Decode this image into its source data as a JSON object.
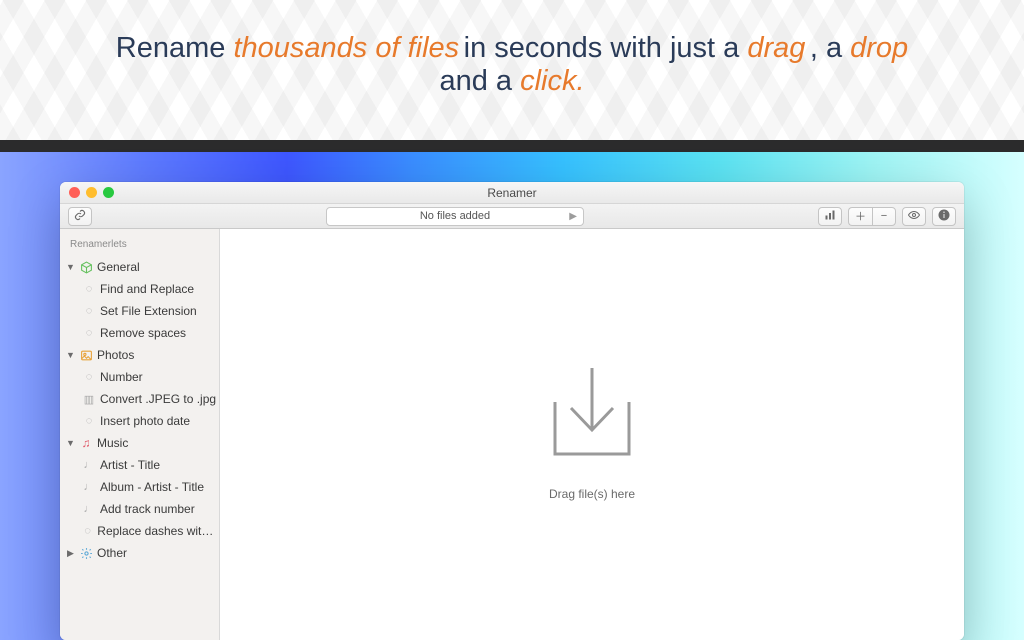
{
  "promo": {
    "p1": "Rename ",
    "em1": "thousands of files",
    "p2": " in seconds with just a ",
    "em2": "drag",
    "p3": ", a ",
    "em3": "drop",
    "p4": " and a ",
    "em4": "click.",
    "p5": ""
  },
  "window": {
    "title": "Renamer",
    "status": "No files added"
  },
  "sidebar": {
    "header": "Renamerlets",
    "groups": [
      {
        "label": "General",
        "items": [
          {
            "label": "Find and Replace"
          },
          {
            "label": "Set File Extension"
          },
          {
            "label": "Remove spaces"
          }
        ]
      },
      {
        "label": "Photos",
        "items": [
          {
            "label": "Number"
          },
          {
            "label": "Convert .JPEG to .jpg"
          },
          {
            "label": "Insert photo date"
          }
        ]
      },
      {
        "label": "Music",
        "items": [
          {
            "label": "Artist - Title"
          },
          {
            "label": "Album - Artist - Title"
          },
          {
            "label": "Add track number"
          },
          {
            "label": "Replace dashes with unde..."
          }
        ]
      },
      {
        "label": "Other",
        "items": []
      }
    ]
  },
  "dropzone": {
    "label": "Drag file(s) here"
  }
}
